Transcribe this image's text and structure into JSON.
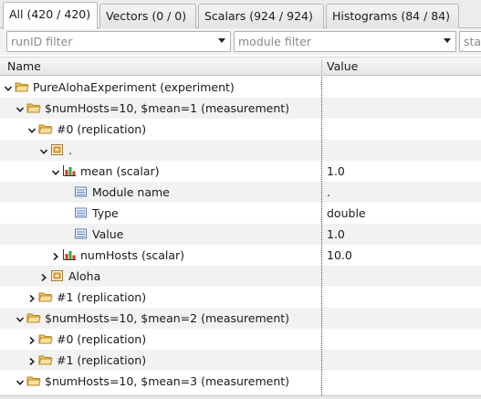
{
  "tabs": [
    {
      "label": "All (420 / 420)"
    },
    {
      "label": "Vectors (0 / 0)"
    },
    {
      "label": "Scalars (924 / 924)"
    },
    {
      "label": "Histograms (84 / 84)"
    }
  ],
  "filters": {
    "run_placeholder": "runID filter",
    "module_placeholder": "module filter",
    "stat_placeholder": "stat"
  },
  "columns": {
    "name": "Name",
    "value": "Value"
  },
  "rows": [
    {
      "label": "PureAlohaExperiment (experiment)",
      "value": "",
      "twisty": "open",
      "icon": "folder"
    },
    {
      "label": "$numHosts=10, $mean=1 (measurement)",
      "value": "",
      "twisty": "open",
      "icon": "folder"
    },
    {
      "label": "#0 (replication)",
      "value": "",
      "twisty": "open",
      "icon": "folder"
    },
    {
      "label": ".",
      "value": "",
      "twisty": "open",
      "icon": "module"
    },
    {
      "label": "mean (scalar)",
      "value": "1.0",
      "twisty": "open",
      "icon": "scalar"
    },
    {
      "label": "Module name",
      "value": ".",
      "twisty": "none",
      "icon": "field"
    },
    {
      "label": "Type",
      "value": "double",
      "twisty": "none",
      "icon": "field"
    },
    {
      "label": "Value",
      "value": "1.0",
      "twisty": "none",
      "icon": "field"
    },
    {
      "label": "numHosts (scalar)",
      "value": "10.0",
      "twisty": "closed",
      "icon": "scalar"
    },
    {
      "label": "Aloha",
      "value": "",
      "twisty": "closed",
      "icon": "module"
    },
    {
      "label": "#1 (replication)",
      "value": "",
      "twisty": "closed",
      "icon": "folder"
    },
    {
      "label": "$numHosts=10, $mean=2 (measurement)",
      "value": "",
      "twisty": "open",
      "icon": "folder"
    },
    {
      "label": "#0 (replication)",
      "value": "",
      "twisty": "closed",
      "icon": "folder"
    },
    {
      "label": "#1 (replication)",
      "value": "",
      "twisty": "closed",
      "icon": "folder"
    },
    {
      "label": "$numHosts=10, $mean=3 (measurement)",
      "value": "",
      "twisty": "open",
      "icon": "folder"
    }
  ],
  "colors": {
    "folder_fill": "#f4c45a",
    "folder_stroke": "#b8862a",
    "module_fill": "#f6b34a",
    "scalar_red": "#d63a2a",
    "scalar_green": "#3aa53a",
    "field_blue": "#5b7fb5"
  }
}
